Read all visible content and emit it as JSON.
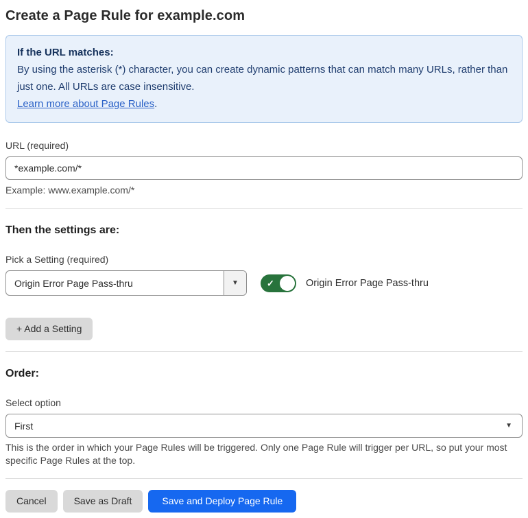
{
  "page": {
    "title": "Create a Page Rule for example.com"
  },
  "info_box": {
    "heading": "If the URL matches:",
    "body": "By using the asterisk (*) character, you can create dynamic patterns that can match many URLs, rather than just one. All URLs are case insensitive.",
    "link_label": "Learn more about Page Rules",
    "link_suffix": "."
  },
  "url_field": {
    "label": "URL (required)",
    "value": "*example.com/*",
    "helper": "Example: www.example.com/*"
  },
  "settings_section": {
    "heading": "Then the settings are:",
    "picker_label": "Pick a Setting (required)",
    "picker_value": "Origin Error Page Pass-thru",
    "toggle_state": "on",
    "toggle_check": "✓",
    "toggle_label": "Origin Error Page Pass-thru",
    "add_setting_label": "+ Add a Setting"
  },
  "order_section": {
    "heading": "Order:",
    "select_label": "Select option",
    "select_value": "First",
    "helper": "This is the order in which your Page Rules will be triggered. Only one Page Rule will trigger per URL, so put your most specific Page Rules at the top."
  },
  "footer": {
    "cancel_label": "Cancel",
    "save_draft_label": "Save as Draft",
    "save_deploy_label": "Save and Deploy Page Rule"
  },
  "icons": {
    "dropdown_caret": "▼"
  },
  "colors": {
    "primary_blue": "#1668f0",
    "toggle_green": "#28733c",
    "info_bg": "#e9f1fb",
    "info_border": "#a9c8ea",
    "info_text": "#1e3c6e",
    "link_blue": "#2a61c7",
    "button_gray": "#d9d9d9",
    "divider_gray": "#dcdcdc"
  }
}
